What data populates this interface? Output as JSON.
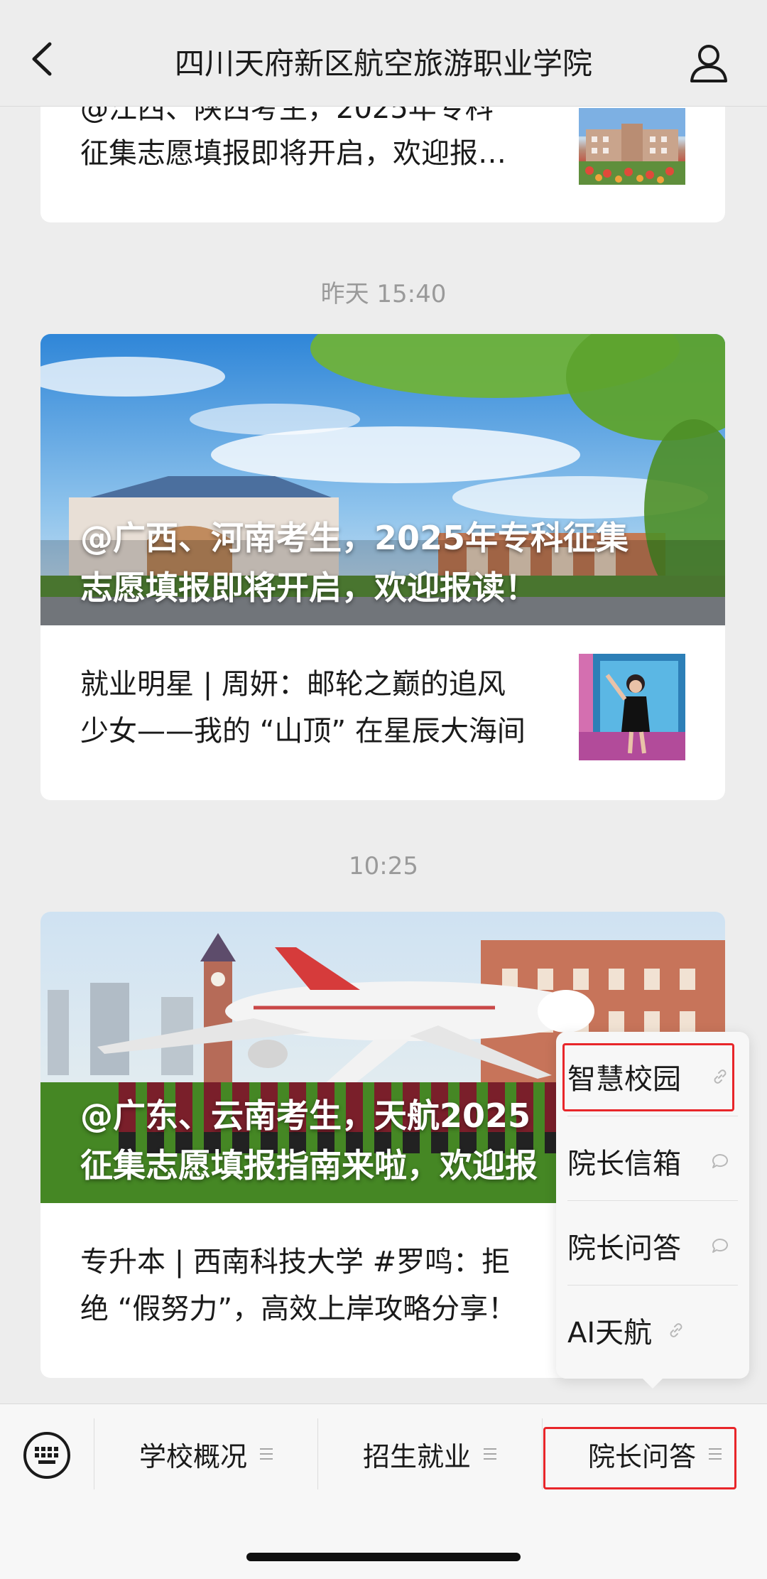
{
  "header": {
    "title": "四川天府新区航空旅游职业学院",
    "back_icon": "chevron-left-icon",
    "profile_icon": "person-icon"
  },
  "feed": {
    "top_card": {
      "text": "@江西、陕西考生，2025年专科征集志愿填报即将开启，欢迎报…",
      "line1": "@江西、陕西考生，2025年专科",
      "line2": "征集志愿填报即将开启，欢迎报…"
    },
    "groups": [
      {
        "timestamp": "昨天 15:40",
        "hero_title_line1": "@广西、河南考生，2025年专科征集",
        "hero_title_line2": "志愿填报即将开启，欢迎报读！",
        "article_line1": "就业明星 | 周妍：邮轮之巅的追风",
        "article_line2": "少女——我的 “山顶” 在星辰大海间"
      },
      {
        "timestamp": "10:25",
        "hero_title_line1": "@广东、云南考生，天航2025",
        "hero_title_line2": "征集志愿填报指南来啦，欢迎报",
        "article_line1": "专升本 | 西南科技大学 #罗鸣：拒",
        "article_line2": "绝 “假努力”，高效上岸攻略分享！"
      }
    ]
  },
  "popup_menu": {
    "items": [
      {
        "label": "智慧校园",
        "icon": "link-icon"
      },
      {
        "label": "院长信箱",
        "icon": "chat-bubble-icon"
      },
      {
        "label": "院长问答",
        "icon": "chat-bubble-icon"
      },
      {
        "label": "AI天航",
        "icon": "link-icon"
      }
    ]
  },
  "menu_bar": {
    "keyboard_icon": "keyboard-icon",
    "tabs": [
      {
        "label": "学校概况"
      },
      {
        "label": "招生就业"
      },
      {
        "label": "院长问答"
      }
    ]
  },
  "colors": {
    "background": "#ededed",
    "card": "#ffffff",
    "highlight": "#e8262a",
    "muted_text": "#9a9a9a"
  }
}
